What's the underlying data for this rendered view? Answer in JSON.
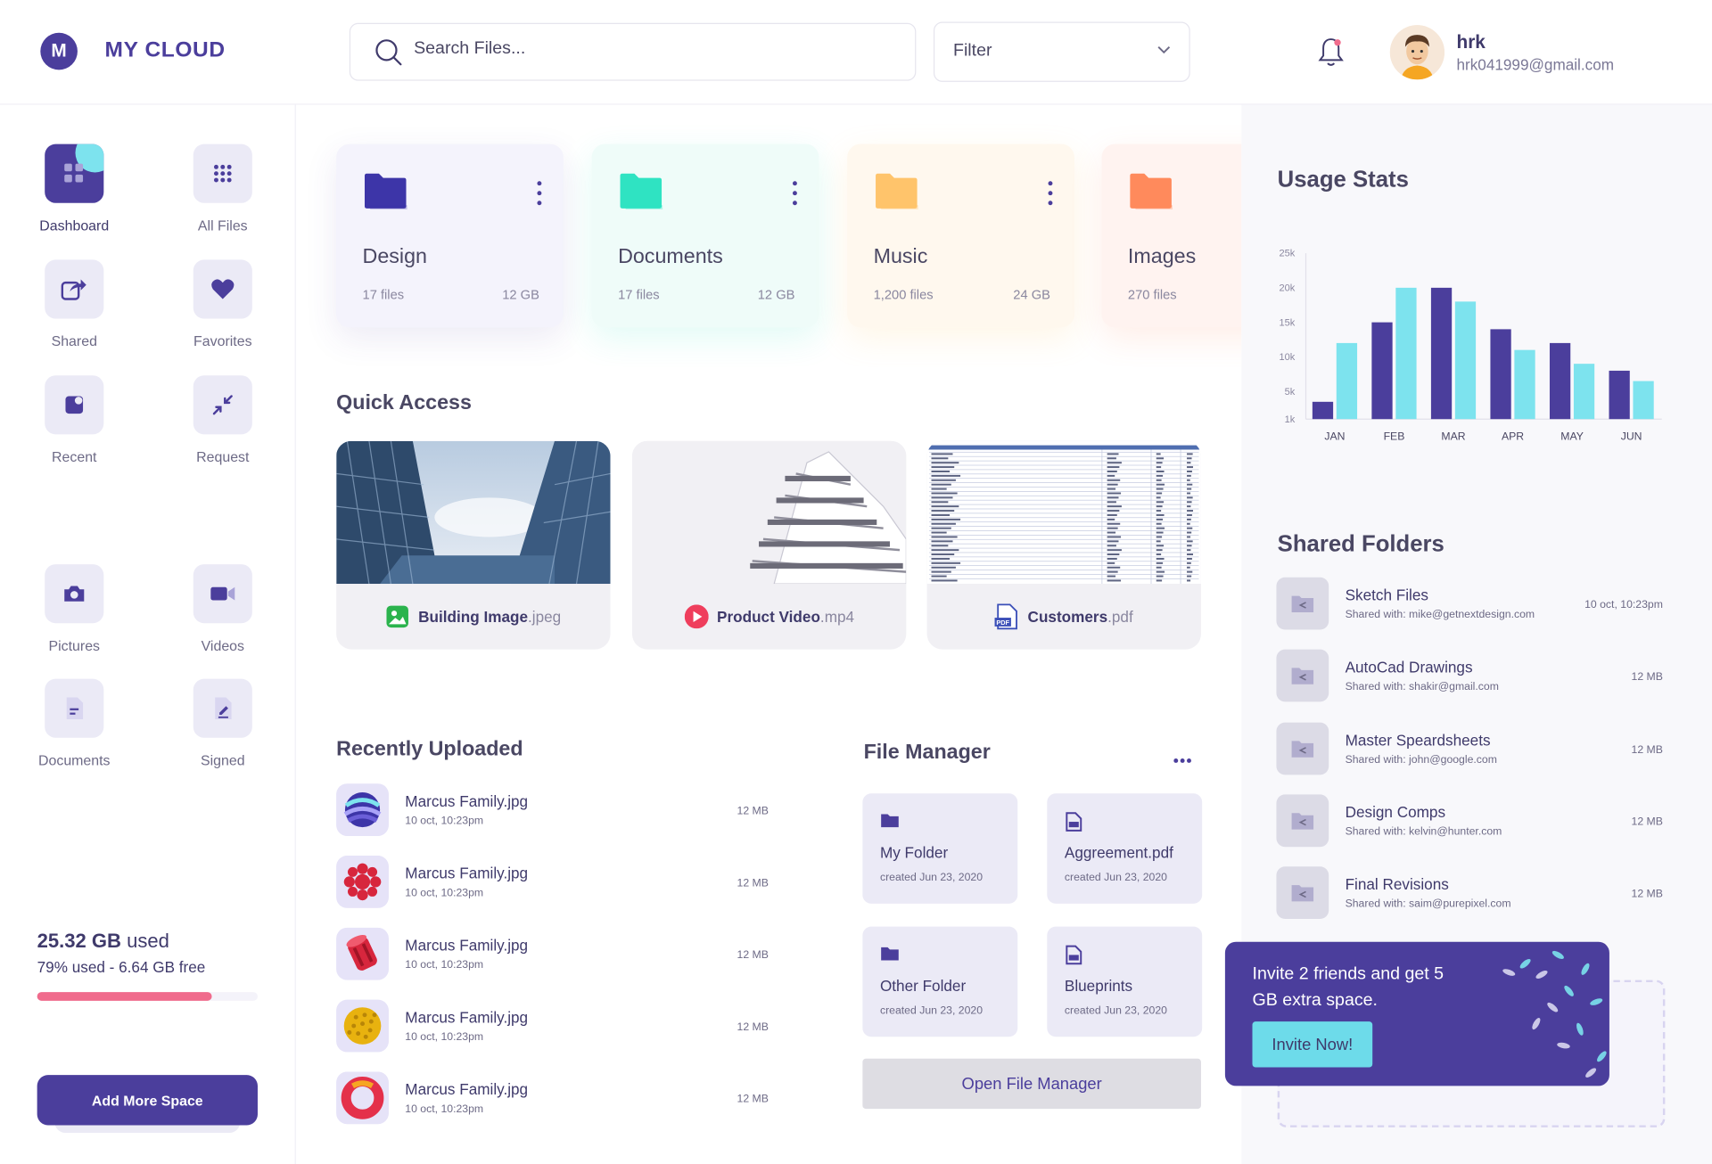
{
  "app": {
    "logo_letter": "M",
    "title": "MY CLOUD"
  },
  "search": {
    "placeholder": "Search Files..."
  },
  "filter": {
    "label": "Filter"
  },
  "user": {
    "name": "hrk",
    "email": "hrk041999@gmail.com"
  },
  "sidebar": {
    "items": [
      {
        "label": "Dashboard",
        "icon": "dashboard-icon",
        "active": true
      },
      {
        "label": "All Files",
        "icon": "grid-icon"
      },
      {
        "label": "Shared",
        "icon": "share-icon"
      },
      {
        "label": "Favorites",
        "icon": "heart-icon"
      },
      {
        "label": "Recent",
        "icon": "recent-icon"
      },
      {
        "label": "Request",
        "icon": "request-icon"
      },
      {
        "label": "Pictures",
        "icon": "camera-icon"
      },
      {
        "label": "Videos",
        "icon": "video-icon"
      },
      {
        "label": "Documents",
        "icon": "document-icon"
      },
      {
        "label": "Signed",
        "icon": "signed-icon"
      }
    ],
    "storage": {
      "used_value": "25.32 GB",
      "used_suffix": " used",
      "detail": "79% used - 6.64 GB free",
      "percent": 79,
      "bar_color": "#f06b8c"
    },
    "add_space_label": "Add More Space"
  },
  "folders": [
    {
      "name": "Design",
      "files": "17 files",
      "size": "12 GB",
      "color": "#3d35a8",
      "bg": "#f4f3fc"
    },
    {
      "name": "Documents",
      "files": "17 files",
      "size": "12 GB",
      "color": "#2fe3c2",
      "bg": "#effcf9"
    },
    {
      "name": "Music",
      "files": "1,200 files",
      "size": "24 GB",
      "color": "#ffc46b",
      "bg": "#fff8ee"
    },
    {
      "name": "Images",
      "files": "270 files",
      "size": "",
      "color": "#ff8a5c",
      "bg": "#fff3f0"
    }
  ],
  "quick_access": {
    "title": "Quick Access",
    "items": [
      {
        "name": "Building Image",
        "ext": ".jpeg"
      },
      {
        "name": "Product Video",
        "ext": ".mp4"
      },
      {
        "name": "Customers",
        "ext": ".pdf"
      }
    ]
  },
  "recently_uploaded": {
    "title": "Recently Uploaded",
    "items": [
      {
        "name": "Marcus Family.jpg",
        "date": "10 oct, 10:23pm",
        "size": "12 MB"
      },
      {
        "name": "Marcus Family.jpg",
        "date": "10 oct, 10:23pm",
        "size": "12 MB"
      },
      {
        "name": "Marcus Family.jpg",
        "date": "10 oct, 10:23pm",
        "size": "12 MB"
      },
      {
        "name": "Marcus Family.jpg",
        "date": "10 oct, 10:23pm",
        "size": "12 MB"
      },
      {
        "name": "Marcus Family.jpg",
        "date": "10 oct, 10:23pm",
        "size": "12 MB"
      }
    ]
  },
  "file_manager": {
    "title": "File Manager",
    "items": [
      {
        "name": "My Folder",
        "date": "created Jun 23, 2020",
        "type": "folder"
      },
      {
        "name": "Aggreement.pdf",
        "date": "created Jun 23, 2020",
        "type": "pdf"
      },
      {
        "name": "Other Folder",
        "date": "created Jun 23, 2020",
        "type": "folder"
      },
      {
        "name": "Blueprints",
        "date": "created Jun 23, 2020",
        "type": "pdf"
      }
    ],
    "open_label": "Open File Manager"
  },
  "usage_stats": {
    "title": "Usage Stats"
  },
  "chart_data": {
    "type": "bar",
    "categories": [
      "JAN",
      "FEB",
      "MAR",
      "APR",
      "MAY",
      "JUN"
    ],
    "series": [
      {
        "values": [
          3500,
          15000,
          20000,
          14000,
          12000,
          8000
        ],
        "color": "#4b3e9c"
      },
      {
        "values": [
          12000,
          20000,
          18000,
          11000,
          9000,
          6500
        ],
        "color": "#7de3ee"
      }
    ],
    "yticks": [
      "25k",
      "20k",
      "15k",
      "10k",
      "5k",
      "1k"
    ],
    "ylim": [
      1000,
      25000
    ],
    "grid": false
  },
  "shared_folders": {
    "title": "Shared Folders",
    "items": [
      {
        "name": "Sketch Files",
        "shared": "Shared with: mike@getnextdesign.com",
        "meta": "10 oct, 10:23pm"
      },
      {
        "name": "AutoCad Drawings",
        "shared": "Shared with: shakir@gmail.com",
        "meta": "12 MB"
      },
      {
        "name": "Master Speardsheets",
        "shared": "Shared with: john@google.com",
        "meta": "12 MB"
      },
      {
        "name": "Design Comps",
        "shared": "Shared with: kelvin@hunter.com",
        "meta": "12 MB"
      },
      {
        "name": "Final Revisions",
        "shared": "Shared with: saim@purepixel.com",
        "meta": "12 MB"
      }
    ]
  },
  "invite": {
    "text": "Invite 2 friends and get 5 GB extra space.",
    "button": "Invite Now!"
  }
}
